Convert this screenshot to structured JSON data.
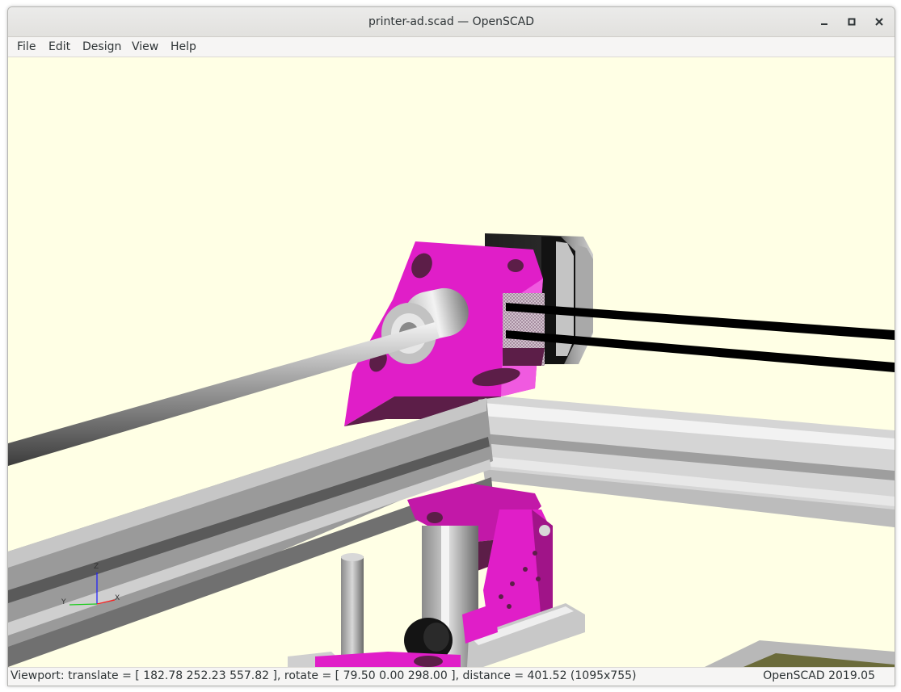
{
  "window": {
    "title": "printer-ad.scad — OpenSCAD",
    "controls": [
      "minimize-icon",
      "maximize-icon",
      "close-icon"
    ]
  },
  "menubar": {
    "items": [
      {
        "label": "File",
        "mnemonic": "F"
      },
      {
        "label": "Edit",
        "mnemonic": "E"
      },
      {
        "label": "Design",
        "mnemonic": "D"
      },
      {
        "label": "View",
        "mnemonic": "V"
      },
      {
        "label": "Help",
        "mnemonic": "H"
      }
    ]
  },
  "viewport": {
    "background_color": "#ffffe5",
    "axes": {
      "x_label": "X",
      "y_label": "Y",
      "z_label": "Z"
    },
    "colors": {
      "part_magenta": "#e01ec8",
      "part_magenta_dark": "#5c1e48",
      "extrusion_silver": "#c8c8c8",
      "belt_black": "#000000"
    }
  },
  "statusbar": {
    "viewport_info": "Viewport: translate = [ 182.78 252.23 557.82 ], rotate = [ 79.50 0.00 298.00 ], distance = 401.52 (1095x755)",
    "version": "OpenSCAD 2019.05"
  }
}
